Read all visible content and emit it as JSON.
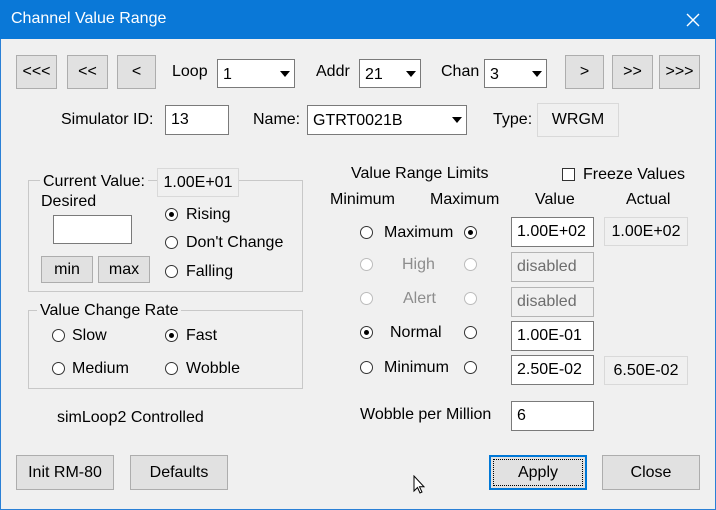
{
  "window": {
    "title": "Channel Value Range"
  },
  "nav": {
    "first": "<<<",
    "prev_fast": "<<",
    "prev": "<",
    "next": ">",
    "next_fast": ">>",
    "last": ">>>"
  },
  "selectors": {
    "loop_label": "Loop",
    "loop_value": "1",
    "addr_label": "Addr",
    "addr_value": "21",
    "chan_label": "Chan",
    "chan_value": "3"
  },
  "info": {
    "simulator_id_label": "Simulator ID:",
    "simulator_id_value": "13",
    "name_label": "Name:",
    "name_value": "GTRT0021B",
    "type_label": "Type:",
    "type_value": "WRGM"
  },
  "current_value": {
    "legend": "Current Value:",
    "value": "1.00E+01",
    "desired_label": "Desired",
    "desired_value": "",
    "min_button": "min",
    "max_button": "max",
    "direction": [
      {
        "label": "Rising",
        "selected": true
      },
      {
        "label": "Don't Change",
        "selected": false
      },
      {
        "label": "Falling",
        "selected": false
      }
    ]
  },
  "change_rate": {
    "legend": "Value Change Rate",
    "options": [
      {
        "label": "Slow",
        "selected": false
      },
      {
        "label": "Fast",
        "selected": true
      },
      {
        "label": "Medium",
        "selected": false
      },
      {
        "label": "Wobble",
        "selected": false
      }
    ]
  },
  "limits": {
    "title": "Value Range Limits",
    "freeze_label": "Freeze Values",
    "freeze_checked": false,
    "col_minimum": "Minimum",
    "col_maximum": "Maximum",
    "col_value": "Value",
    "col_actual": "Actual",
    "rows": [
      {
        "label": "Maximum",
        "min_selected": false,
        "max_selected": true,
        "value": "1.00E+02",
        "actual": "1.00E+02",
        "enabled": true
      },
      {
        "label": "High",
        "min_selected": false,
        "max_selected": false,
        "value": "disabled",
        "actual": "",
        "enabled": false
      },
      {
        "label": "Alert",
        "min_selected": false,
        "max_selected": false,
        "value": "disabled",
        "actual": "",
        "enabled": false
      },
      {
        "label": "Normal",
        "min_selected": true,
        "max_selected": false,
        "value": "1.00E-01",
        "actual": "",
        "enabled": true
      },
      {
        "label": "Minimum",
        "min_selected": false,
        "max_selected": false,
        "value": "2.50E-02",
        "actual": "6.50E-02",
        "enabled": true
      }
    ],
    "wobble_label": "Wobble per Million",
    "wobble_value": "6"
  },
  "status": {
    "controlled_text": "simLoop2 Controlled"
  },
  "buttons": {
    "init": "Init RM-80",
    "defaults": "Defaults",
    "apply": "Apply",
    "close": "Close"
  }
}
